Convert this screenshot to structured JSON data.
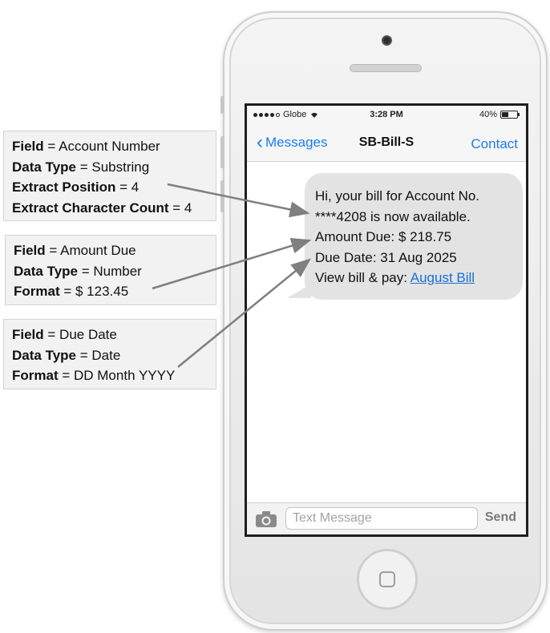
{
  "phone": {
    "status_bar": {
      "carrier": "Globe",
      "time": "3:28 PM",
      "battery": "40%"
    },
    "nav": {
      "back_label": "Messages",
      "title": "SB-Bill-S",
      "contact_label": "Contact"
    },
    "message": {
      "line1": "Hi, your bill for Account No.",
      "line2": "****4208 is now available.",
      "line3": "Amount Due: $ 218.75",
      "line4": "Due Date: 31 Aug 2025",
      "line5_prefix": "View bill & pay: ",
      "link_text": "August Bill"
    },
    "input": {
      "placeholder": "Text Message",
      "send_label": "Send"
    }
  },
  "callouts": [
    {
      "rows": [
        {
          "key": "Field",
          "value": " = Account Number"
        },
        {
          "key": "Data Type",
          "value": " = Substring"
        },
        {
          "key": "Extract Position",
          "value": " = 4"
        },
        {
          "key": "Extract Character Count",
          "value": " = 4"
        }
      ]
    },
    {
      "rows": [
        {
          "key": "Field",
          "value": " = Amount Due"
        },
        {
          "key": "Data Type",
          "value": " = Number"
        },
        {
          "key": "Format",
          "value": " = $ 123.45"
        }
      ]
    },
    {
      "rows": [
        {
          "key": "Field",
          "value": " = Due Date"
        },
        {
          "key": "Data Type",
          "value": " = Date"
        },
        {
          "key": "Format",
          "value": " = DD Month YYYY"
        }
      ]
    }
  ],
  "colors": {
    "ios_blue": "#1a7cf1",
    "link_blue": "#1a6fd8",
    "bubble_gray": "#e3e3e3",
    "arrow_gray": "#7f7f7f"
  }
}
